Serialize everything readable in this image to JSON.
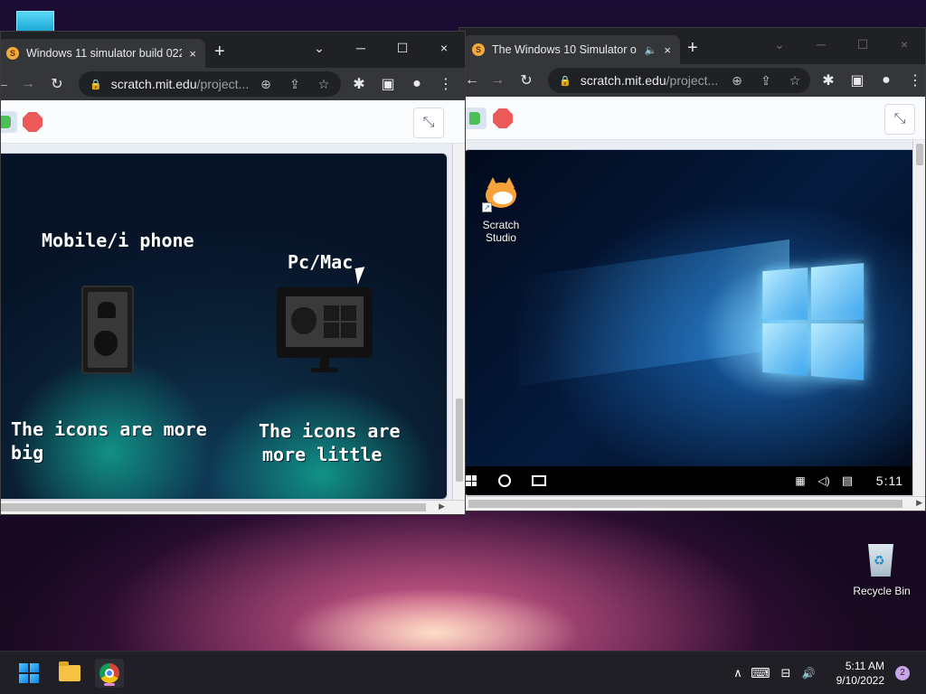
{
  "left_window": {
    "tab_title": "Windows 11 simulator build 022…",
    "url_domain": "scratch.mit.edu",
    "url_path": "/project...",
    "stage": {
      "left_heading": "Mobile/i phone",
      "right_heading": "Pc/Mac",
      "left_caption_line1": "The icons are more",
      "left_caption_line2": "big",
      "right_caption_line1": "The icons are",
      "right_caption_line2": "more little"
    }
  },
  "right_window": {
    "tab_title": "The Windows 10 Simulator o",
    "url_domain": "scratch.mit.edu",
    "url_path": "/project...",
    "desktop_icon_label_line1": "Scratch",
    "desktop_icon_label_line2": "Studio",
    "taskbar_time": "5:11"
  },
  "desktop": {
    "recycle_bin_label": "Recycle Bin"
  },
  "taskbar": {
    "time": "5:11 AM",
    "date": "9/10/2022",
    "notification_count": "2"
  },
  "icons": {
    "close": "×",
    "new_tab": "+",
    "minimize": "─",
    "maximize": "☐",
    "chevron_down": "⌄",
    "back": "←",
    "forward": "→",
    "reload": "↻",
    "lock": "🔒",
    "zoom": "⊕",
    "share": "⇪",
    "star": "☆",
    "extensions": "✱",
    "sidepanel": "▣",
    "profile": "●",
    "menu": "⋮",
    "fullscreen_exit": "⤡",
    "speaker": "🔈",
    "chevron_up": "∧",
    "keyboard": "⌨",
    "network": "⊟",
    "volume": "🔊"
  },
  "colors": {
    "chrome_dark": "#202124",
    "chrome_toolbar": "#35363a",
    "scratch_stop": "#ec5959",
    "scratch_flag": "#4cbf56",
    "win11_accent": "#0f7fe0"
  }
}
